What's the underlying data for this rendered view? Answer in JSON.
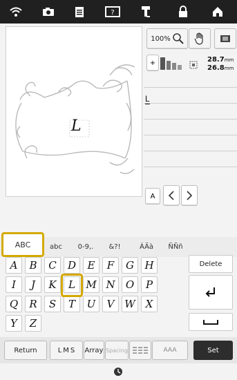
{
  "top_icons": [
    "wifi-icon",
    "camera-icon",
    "document-icon",
    "help-icon",
    "thread-icon",
    "lock-icon",
    "home-icon"
  ],
  "toolbar": {
    "zoom_label": "100%"
  },
  "size": {
    "width": "28.7",
    "height": "26.8",
    "unit": "mm"
  },
  "text_line": {
    "value": "L"
  },
  "preview": {
    "letter": "L"
  },
  "font_button": {
    "label": "A"
  },
  "tabs": [
    "ABC",
    "abc",
    "0-9,.",
    "&?!",
    "ÁÄà",
    "ÑÑñ"
  ],
  "keys": {
    "row1": [
      "A",
      "B",
      "C",
      "D",
      "E",
      "F",
      "G",
      "H"
    ],
    "row2": [
      "I",
      "J",
      "K",
      "L",
      "M",
      "N",
      "O",
      "P"
    ],
    "row3": [
      "Q",
      "R",
      "S",
      "T",
      "U",
      "V",
      "W",
      "X"
    ],
    "row4": [
      "Y",
      "Z"
    ]
  },
  "side_keys": {
    "delete": "Delete",
    "enter": "↵",
    "space": "␣"
  },
  "bottom": {
    "return": "Return",
    "size_l": "L",
    "size_m": "M",
    "size_s": "S",
    "array": "Array",
    "spacing": "Spacing",
    "align_icon": "align-icon",
    "aaa": "AAA",
    "set": "Set"
  },
  "colors": {
    "highlight": "#d4a900",
    "topbar": "#202020",
    "set": "#2d2d2d"
  }
}
